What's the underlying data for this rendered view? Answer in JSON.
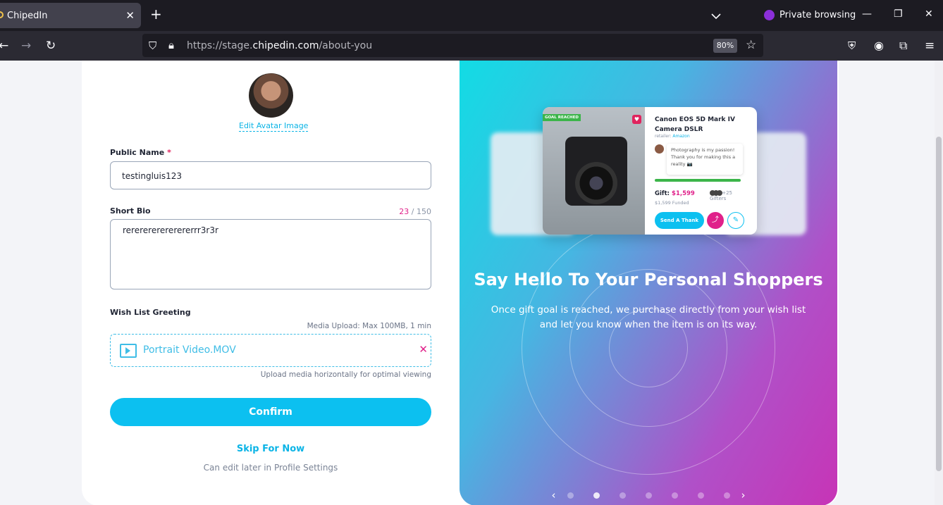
{
  "browser": {
    "tab_title": "ChipedIn",
    "url_host_prefix": "https://stage.",
    "url_host": "chipedin.com",
    "url_path": "/about-you",
    "zoom": "80%",
    "private_label": "Private browsing"
  },
  "form": {
    "edit_avatar": "Edit Avatar Image",
    "public_name_label": "Public Name",
    "required_mark": "*",
    "public_name_value": "testingluis123",
    "short_bio_label": "Short Bio",
    "bio_count": "23",
    "bio_max": "/ 150",
    "bio_value": "rererererererererrr3r3r",
    "wish_label": "Wish List Greeting",
    "media_limit": "Media Upload: Max 100MB, 1 min",
    "media_file": "Portrait Video.MOV",
    "media_hint": "Upload media horizontally for optimal viewing",
    "confirm": "Confirm",
    "skip": "Skip For Now",
    "later": "Can edit later in Profile Settings"
  },
  "hero": {
    "goal_badge": "GOAL REACHED",
    "product_name": "Canon EOS 5D Mark IV Camera DSLR",
    "retailer_label": "retailer:",
    "retailer": "Amazon",
    "message": "Photography is my passion! Thank you for making this a reality 📷",
    "gift_label": "Gift:",
    "gift_amount": "$1,599",
    "funded": "$1,599 Funded",
    "gifters_count": "+25",
    "gifters_label": "Gifters",
    "thank_you": "Send A Thank You",
    "headline": "Say Hello To Your Personal Shoppers",
    "subtext": "Once gift goal is reached, we purchase directly from your wish list and let you know when the item is on its way.",
    "slides_total": 7,
    "active_slide": 2
  },
  "colors": {
    "accent": "#0cc0f0",
    "pink": "#e0218a"
  }
}
